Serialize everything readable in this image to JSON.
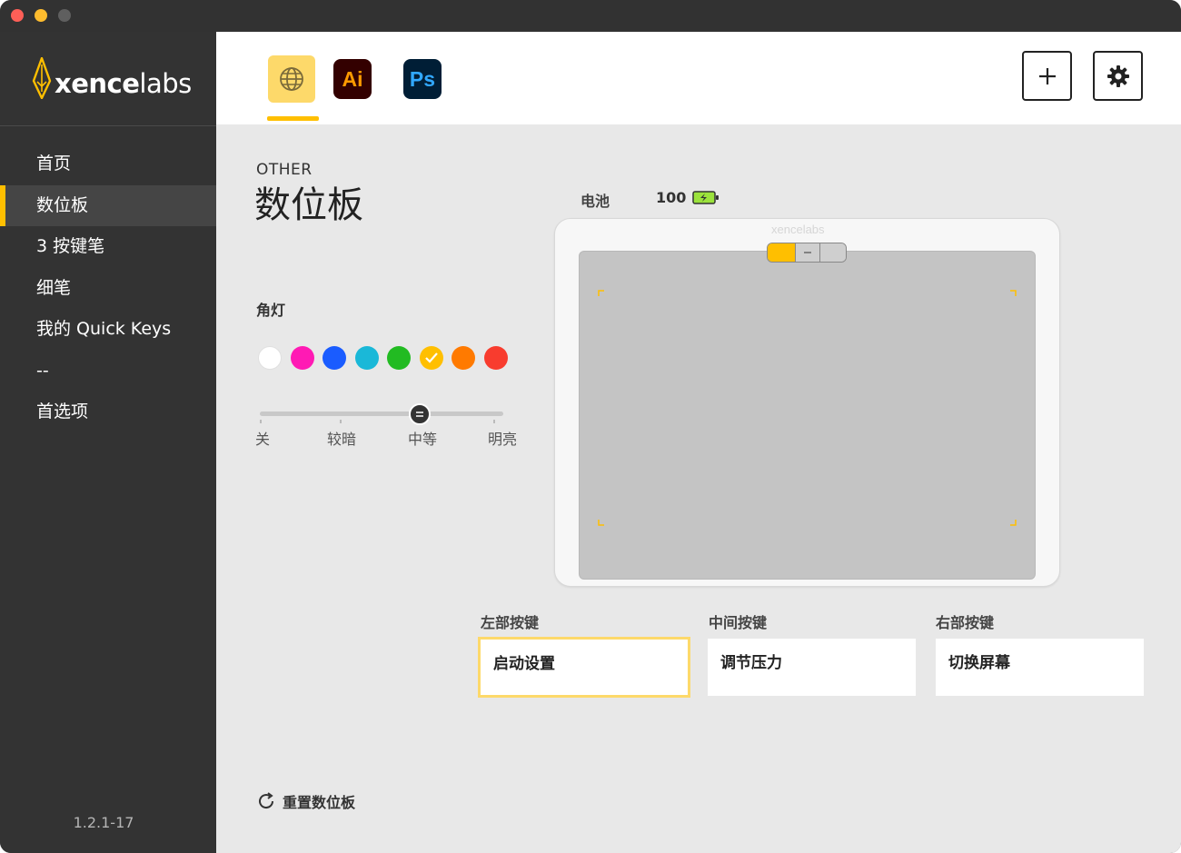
{
  "window": {
    "traffic_lights": [
      "close",
      "minimize",
      "maximize"
    ]
  },
  "sidebar": {
    "logo_text_bold": "xence",
    "logo_text_light": "labs",
    "items": [
      {
        "label": "首页"
      },
      {
        "label": "数位板",
        "active": true
      },
      {
        "label": "3 按键笔"
      },
      {
        "label": "细笔"
      },
      {
        "label": "我的 Quick Keys"
      },
      {
        "label": "--"
      },
      {
        "label": "首选项"
      }
    ],
    "version": "1.2.1-17"
  },
  "topbar": {
    "apps": [
      {
        "name": "global",
        "icon": "globe-icon",
        "selected": true
      },
      {
        "name": "Illustrator",
        "label": "Ai",
        "color": "#ff9a00",
        "bg": "#330000"
      },
      {
        "name": "Photoshop",
        "label": "Ps",
        "color": "#31a8ff",
        "bg": "#001e36"
      }
    ],
    "add_icon": "plus-icon",
    "settings_icon": "gear-icon"
  },
  "main": {
    "subtitle": "OTHER",
    "title": "数位板",
    "battery_label": "电池",
    "battery_value": "100",
    "corner_light_label": "角灯",
    "colors": [
      "#ffffff",
      "#ff1ab4",
      "#1a5cff",
      "#1ab8d8",
      "#22bb22",
      "#ffbf00",
      "#ff7a00",
      "#f83c2e"
    ],
    "selected_color": "#ffbf00",
    "brightness": {
      "levels": [
        "关",
        "较暗",
        "中等",
        "明亮"
      ],
      "selected": "中等"
    },
    "tablet_brand": "xencelabs",
    "keys": [
      {
        "label": "左部按键",
        "value": "启动设置",
        "selected": true
      },
      {
        "label": "中间按键",
        "value": "调节压力"
      },
      {
        "label": "右部按键",
        "value": "切换屏幕"
      }
    ],
    "reset_label": "重置数位板"
  },
  "colors": {
    "accent": "#ffbf00",
    "sidebar_bg": "#333333",
    "content_bg": "#e8e8e8"
  }
}
